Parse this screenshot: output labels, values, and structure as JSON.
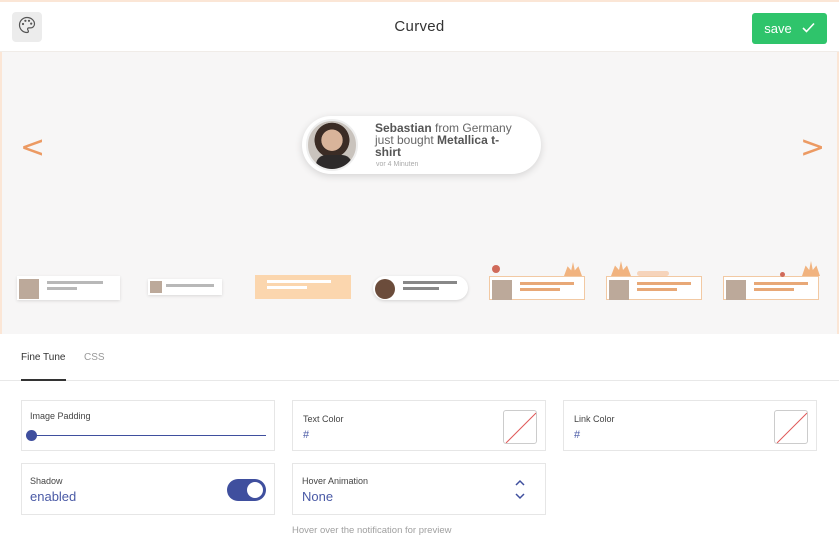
{
  "header": {
    "title": "Curved",
    "save_label": "save",
    "palette_icon": "palette-icon",
    "check_icon": "check-icon"
  },
  "preview": {
    "prev_arrow": "<",
    "next_arrow": ">",
    "notification": {
      "name": "Sebastian",
      "from_text": " from Germany just bought ",
      "product": "Metallica t-shirt",
      "time": "vor 4 Minuten"
    }
  },
  "tabs": [
    {
      "label": "Fine Tune",
      "active": true
    },
    {
      "label": "CSS",
      "active": false
    }
  ],
  "settings": {
    "image_padding": {
      "label": "Image Padding",
      "value_fraction": 0.0
    },
    "text_color": {
      "label": "Text Color",
      "value": "#"
    },
    "link_color": {
      "label": "Link Color",
      "value": "#"
    },
    "shadow": {
      "label": "Shadow",
      "value": "enabled",
      "on": true
    },
    "hover_animation": {
      "label": "Hover Animation",
      "value": "None"
    }
  },
  "hint": "Hover over the notification for preview",
  "colors": {
    "accent": "#3f4f9e",
    "save": "#2fc46b",
    "arrow": "#ec9a63"
  }
}
